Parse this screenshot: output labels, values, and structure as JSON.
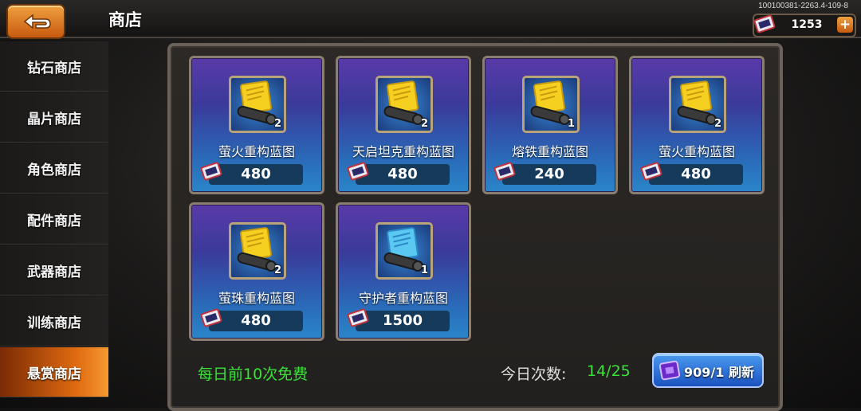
{
  "header": {
    "title": "商店",
    "build_id": "100100381-2263.4-109-8"
  },
  "currency": {
    "amount": "1253",
    "plus": "+"
  },
  "sidebar": {
    "items": [
      {
        "label": "钻石商店",
        "active": false
      },
      {
        "label": "晶片商店",
        "active": false
      },
      {
        "label": "角色商店",
        "active": false
      },
      {
        "label": "配件商店",
        "active": false
      },
      {
        "label": "武器商店",
        "active": false
      },
      {
        "label": "训练商店",
        "active": false
      },
      {
        "label": "悬赏商店",
        "active": true
      }
    ]
  },
  "items": [
    {
      "name": "萤火重构蓝图",
      "qty": "2",
      "price": "480",
      "icon": "gold-blueprint-icon"
    },
    {
      "name": "天启坦克重构蓝图",
      "qty": "2",
      "price": "480",
      "icon": "gold-blueprint-icon"
    },
    {
      "name": "熔铁重构蓝图",
      "qty": "1",
      "price": "240",
      "icon": "gold-blueprint-icon"
    },
    {
      "name": "萤火重构蓝图",
      "qty": "2",
      "price": "480",
      "icon": "gold-blueprint-icon"
    },
    {
      "name": "萤珠重构蓝图",
      "qty": "2",
      "price": "480",
      "icon": "gold-blueprint-icon"
    },
    {
      "name": "守护者重构蓝图",
      "qty": "1",
      "price": "1500",
      "icon": "blue-blueprint-icon"
    }
  ],
  "footer": {
    "free_text": "每日前10次免费",
    "count_label": "今日次数:",
    "count_value": "14/25",
    "refresh_label": "909/1 刷新"
  },
  "colors": {
    "accent_orange": "#e06a10",
    "free_green": "#38e238",
    "card_purple": "#5a3aa8",
    "card_blue": "#2a86c8"
  }
}
